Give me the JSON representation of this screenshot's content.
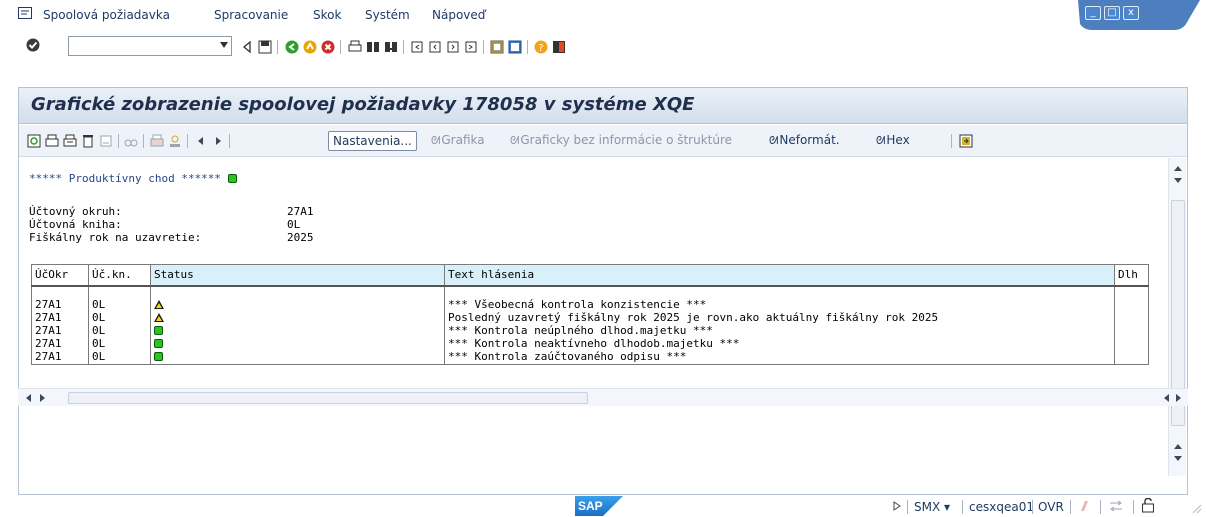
{
  "menu": {
    "items": [
      "Spoolová požiadavka",
      "Spracovanie",
      "Skok",
      "Systém",
      "Nápoveď"
    ]
  },
  "window_controls": {
    "minimize": "_",
    "maximize": "□",
    "close": "x"
  },
  "system_toolbar": {
    "command_field_value": "",
    "icons": [
      "enter-icon",
      "back-icon",
      "save-icon",
      "back-nav-icon",
      "exit-icon",
      "cancel-icon",
      "print-icon",
      "find-icon",
      "find-next-icon",
      "first-page-icon",
      "previous-page-icon",
      "next-page-icon",
      "last-page-icon",
      "new-session-icon",
      "shortcut-icon",
      "help-icon",
      "customize-layout-icon"
    ]
  },
  "title": "Grafické zobrazenie spoolovej požiadavky 178058 v systéme XQE",
  "app_toolbar": {
    "settings_label": "Nastavenia...",
    "graphics_label": "Grafika",
    "graphics_no_structure_label": "Graficky bez informácie o štruktúre",
    "unformatted_label": "Neformát.",
    "hex_label": "Hex"
  },
  "report": {
    "header_line": "***** Produktívny chod ******",
    "fields": [
      {
        "label": "Účtovný okruh:",
        "value": "27A1"
      },
      {
        "label": "Účtovná kniha:",
        "value": "0L"
      },
      {
        "label": "Fiškálny rok na uzavretie:",
        "value": "2025"
      }
    ]
  },
  "table": {
    "columns": [
      "ÚčOkr",
      "Úč.kn.",
      "Status",
      "Text hlásenia",
      "Dlh"
    ],
    "rows": [
      {
        "company": "27A1",
        "ledger": "0L",
        "status": "warning",
        "text": "*** Všeobecná kontrola konzistencie ***"
      },
      {
        "company": "27A1",
        "ledger": "0L",
        "status": "warning",
        "text": "Posledný uzavretý fiškálny rok 2025 je rovn.ako aktuálny fiškálny rok 2025"
      },
      {
        "company": "27A1",
        "ledger": "0L",
        "status": "ok",
        "text": "*** Kontrola neúplného dlhod.majetku ***"
      },
      {
        "company": "27A1",
        "ledger": "0L",
        "status": "ok",
        "text": "*** Kontrola neaktívneho dlhodob.majetku ***"
      },
      {
        "company": "27A1",
        "ledger": "0L",
        "status": "ok",
        "text": "*** Kontrola zaúčtovaného odpisu ***"
      }
    ]
  },
  "status_bar": {
    "logo": "SAP",
    "system": "SMX",
    "server": "cesxqea01",
    "mode": "OVR"
  },
  "colors": {
    "title_text": "#1f2f4c",
    "menu_text": "#1f3b62",
    "header_highlight": "#d8f0fa",
    "led_green": "#2cc51f",
    "warning_yellow": "#f5d800"
  }
}
